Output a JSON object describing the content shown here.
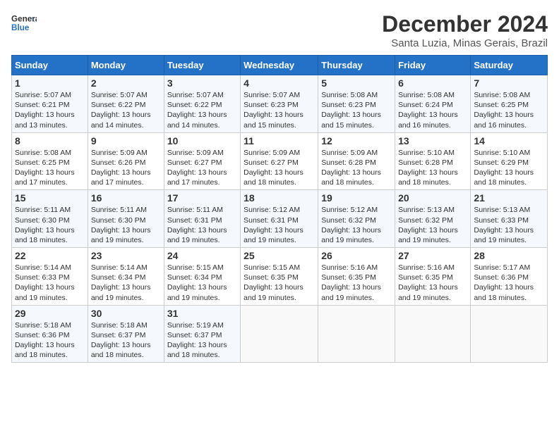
{
  "header": {
    "logo_line1": "General",
    "logo_line2": "Blue",
    "title": "December 2024",
    "location": "Santa Luzia, Minas Gerais, Brazil"
  },
  "days_of_week": [
    "Sunday",
    "Monday",
    "Tuesday",
    "Wednesday",
    "Thursday",
    "Friday",
    "Saturday"
  ],
  "weeks": [
    [
      {
        "day": "1",
        "sunrise": "5:07 AM",
        "sunset": "6:21 PM",
        "daylight": "13 hours and 13 minutes."
      },
      {
        "day": "2",
        "sunrise": "5:07 AM",
        "sunset": "6:22 PM",
        "daylight": "13 hours and 14 minutes."
      },
      {
        "day": "3",
        "sunrise": "5:07 AM",
        "sunset": "6:22 PM",
        "daylight": "13 hours and 14 minutes."
      },
      {
        "day": "4",
        "sunrise": "5:07 AM",
        "sunset": "6:23 PM",
        "daylight": "13 hours and 15 minutes."
      },
      {
        "day": "5",
        "sunrise": "5:08 AM",
        "sunset": "6:23 PM",
        "daylight": "13 hours and 15 minutes."
      },
      {
        "day": "6",
        "sunrise": "5:08 AM",
        "sunset": "6:24 PM",
        "daylight": "13 hours and 16 minutes."
      },
      {
        "day": "7",
        "sunrise": "5:08 AM",
        "sunset": "6:25 PM",
        "daylight": "13 hours and 16 minutes."
      }
    ],
    [
      {
        "day": "8",
        "sunrise": "5:08 AM",
        "sunset": "6:25 PM",
        "daylight": "13 hours and 17 minutes."
      },
      {
        "day": "9",
        "sunrise": "5:09 AM",
        "sunset": "6:26 PM",
        "daylight": "13 hours and 17 minutes."
      },
      {
        "day": "10",
        "sunrise": "5:09 AM",
        "sunset": "6:27 PM",
        "daylight": "13 hours and 17 minutes."
      },
      {
        "day": "11",
        "sunrise": "5:09 AM",
        "sunset": "6:27 PM",
        "daylight": "13 hours and 18 minutes."
      },
      {
        "day": "12",
        "sunrise": "5:09 AM",
        "sunset": "6:28 PM",
        "daylight": "13 hours and 18 minutes."
      },
      {
        "day": "13",
        "sunrise": "5:10 AM",
        "sunset": "6:28 PM",
        "daylight": "13 hours and 18 minutes."
      },
      {
        "day": "14",
        "sunrise": "5:10 AM",
        "sunset": "6:29 PM",
        "daylight": "13 hours and 18 minutes."
      }
    ],
    [
      {
        "day": "15",
        "sunrise": "5:11 AM",
        "sunset": "6:30 PM",
        "daylight": "13 hours and 18 minutes."
      },
      {
        "day": "16",
        "sunrise": "5:11 AM",
        "sunset": "6:30 PM",
        "daylight": "13 hours and 19 minutes."
      },
      {
        "day": "17",
        "sunrise": "5:11 AM",
        "sunset": "6:31 PM",
        "daylight": "13 hours and 19 minutes."
      },
      {
        "day": "18",
        "sunrise": "5:12 AM",
        "sunset": "6:31 PM",
        "daylight": "13 hours and 19 minutes."
      },
      {
        "day": "19",
        "sunrise": "5:12 AM",
        "sunset": "6:32 PM",
        "daylight": "13 hours and 19 minutes."
      },
      {
        "day": "20",
        "sunrise": "5:13 AM",
        "sunset": "6:32 PM",
        "daylight": "13 hours and 19 minutes."
      },
      {
        "day": "21",
        "sunrise": "5:13 AM",
        "sunset": "6:33 PM",
        "daylight": "13 hours and 19 minutes."
      }
    ],
    [
      {
        "day": "22",
        "sunrise": "5:14 AM",
        "sunset": "6:33 PM",
        "daylight": "13 hours and 19 minutes."
      },
      {
        "day": "23",
        "sunrise": "5:14 AM",
        "sunset": "6:34 PM",
        "daylight": "13 hours and 19 minutes."
      },
      {
        "day": "24",
        "sunrise": "5:15 AM",
        "sunset": "6:34 PM",
        "daylight": "13 hours and 19 minutes."
      },
      {
        "day": "25",
        "sunrise": "5:15 AM",
        "sunset": "6:35 PM",
        "daylight": "13 hours and 19 minutes."
      },
      {
        "day": "26",
        "sunrise": "5:16 AM",
        "sunset": "6:35 PM",
        "daylight": "13 hours and 19 minutes."
      },
      {
        "day": "27",
        "sunrise": "5:16 AM",
        "sunset": "6:35 PM",
        "daylight": "13 hours and 19 minutes."
      },
      {
        "day": "28",
        "sunrise": "5:17 AM",
        "sunset": "6:36 PM",
        "daylight": "13 hours and 18 minutes."
      }
    ],
    [
      {
        "day": "29",
        "sunrise": "5:18 AM",
        "sunset": "6:36 PM",
        "daylight": "13 hours and 18 minutes."
      },
      {
        "day": "30",
        "sunrise": "5:18 AM",
        "sunset": "6:37 PM",
        "daylight": "13 hours and 18 minutes."
      },
      {
        "day": "31",
        "sunrise": "5:19 AM",
        "sunset": "6:37 PM",
        "daylight": "13 hours and 18 minutes."
      },
      null,
      null,
      null,
      null
    ]
  ]
}
